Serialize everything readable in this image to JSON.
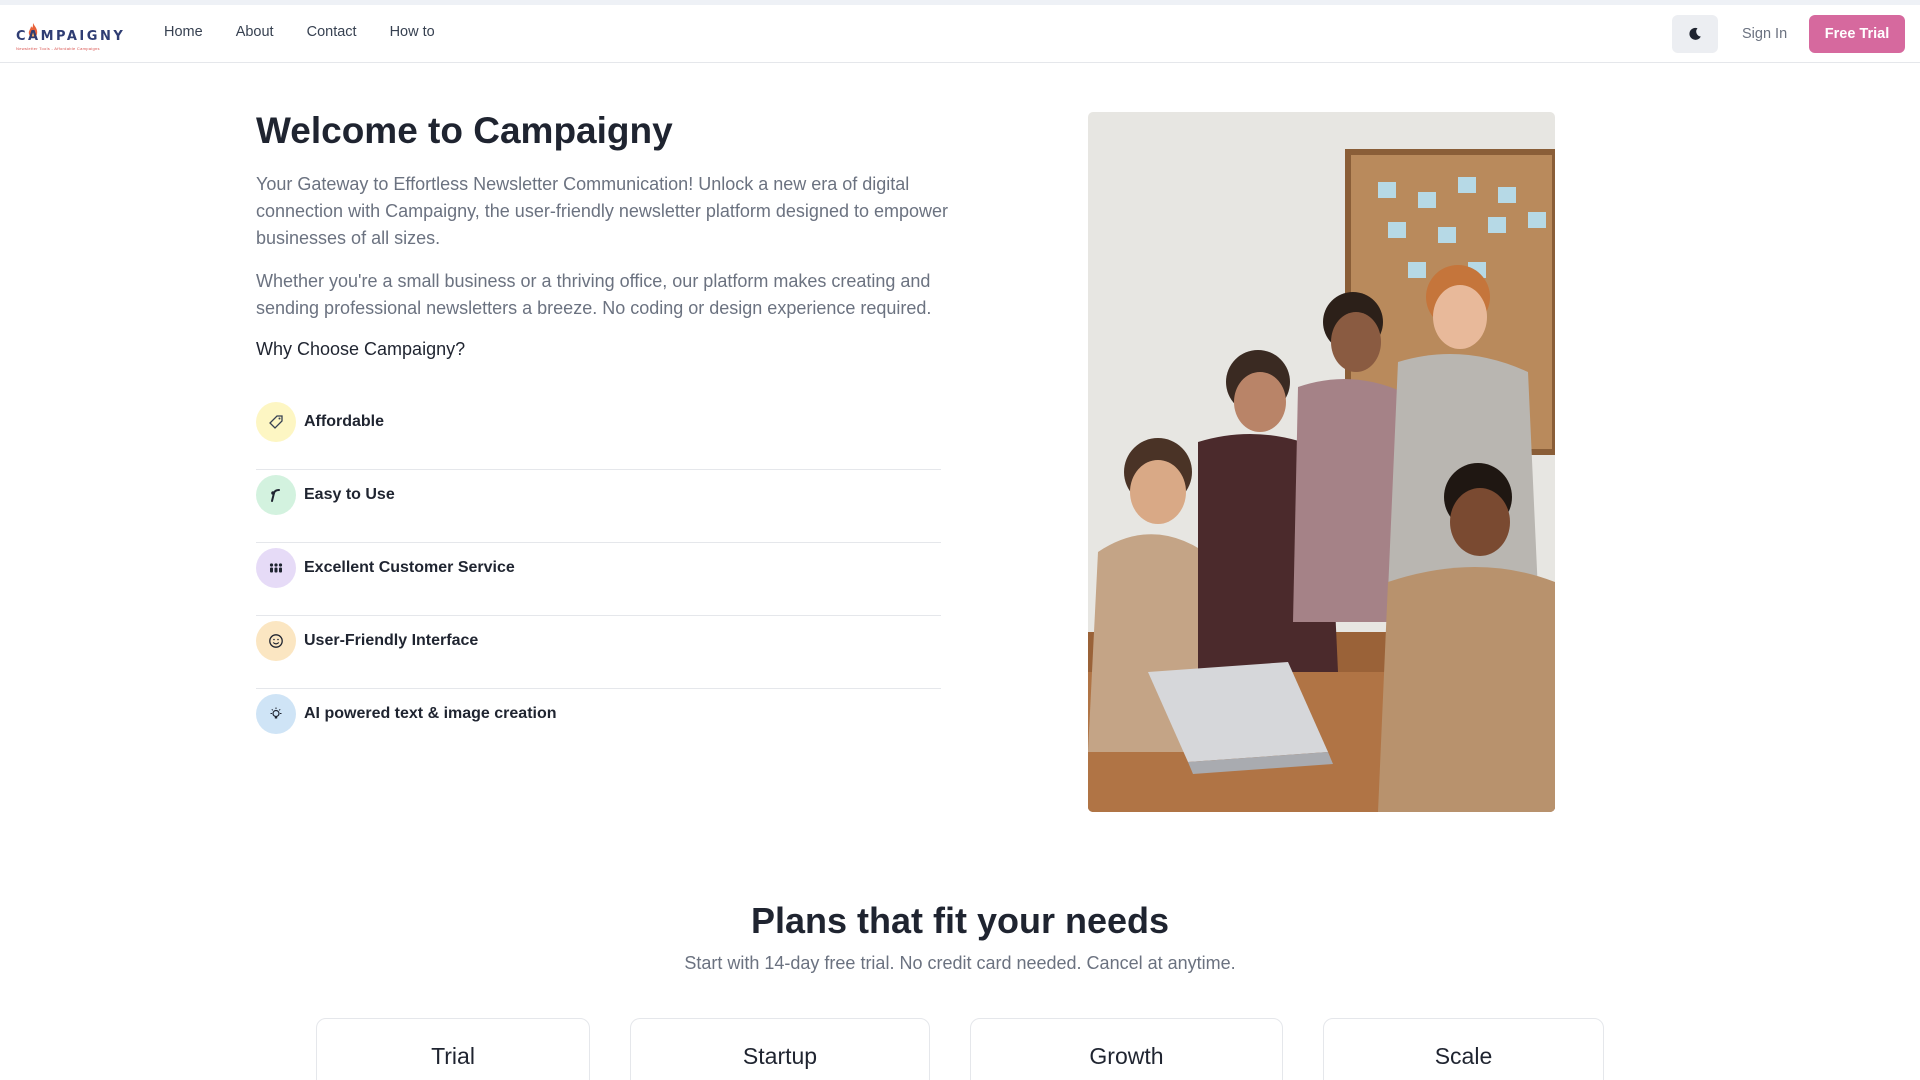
{
  "brand": {
    "name": "CAMPAIGNY",
    "tagline": "Newsletter Tools - Affordable Campaigns"
  },
  "nav": {
    "links": [
      "Home",
      "About",
      "Contact",
      "How to"
    ]
  },
  "header": {
    "theme_toggle_icon": "moon-icon",
    "signin_label": "Sign In",
    "trial_label": "Free Trial",
    "accent_color": "#d6699e"
  },
  "hero": {
    "title": "Welcome to Campaigny",
    "paragraph1": "Your Gateway to Effortless Newsletter Communication! Unlock a new era of digital connection with Campaigny, the user-friendly newsletter platform designed to empower businesses of all sizes.",
    "paragraph2": "Whether you're a small business or a thriving office, our platform makes creating and sending professional newsletters a breeze. No coding or design experience required.",
    "why_heading": "Why Choose Campaigny?",
    "features": [
      {
        "label": "Affordable",
        "icon": "tag-icon",
        "color": "#fdf6c3"
      },
      {
        "label": "Easy to Use",
        "icon": "gesture-icon",
        "color": "#d3f2df"
      },
      {
        "label": "Excellent Customer Service",
        "icon": "people-icon",
        "color": "#e6dbf7"
      },
      {
        "label": "User-Friendly Interface",
        "icon": "smile-icon",
        "color": "#fbe6c2"
      },
      {
        "label": "AI powered text & image creation",
        "icon": "lightbulb-icon",
        "color": "#cfe4f6"
      }
    ],
    "image_icon": "team-photo"
  },
  "plans": {
    "title": "Plans that fit your needs",
    "subtitle": "Start with 14-day free trial. No credit card needed. Cancel at anytime.",
    "items": [
      "Trial",
      "Startup",
      "Growth",
      "Scale"
    ]
  }
}
